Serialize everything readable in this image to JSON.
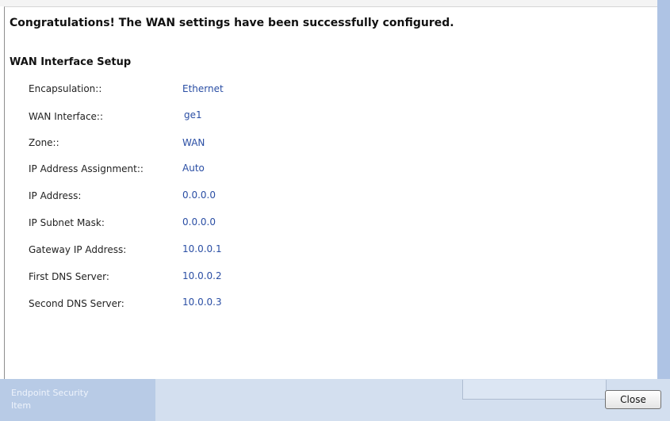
{
  "message": "Congratulations! The WAN settings have been successfully configured.",
  "section_title": "WAN Interface Setup",
  "fields": [
    {
      "label": "Encapsulation::",
      "value": "Ethernet"
    },
    {
      "label": "WAN Interface::",
      "value": "ge1"
    },
    {
      "label": "Zone::",
      "value": "WAN"
    },
    {
      "label": "IP Address Assignment::",
      "value": "Auto"
    },
    {
      "label": "IP Address:",
      "value": "0.0.0.0"
    },
    {
      "label": "IP Subnet Mask:",
      "value": "0.0.0.0"
    },
    {
      "label": "Gateway IP Address:",
      "value": "10.0.0.1"
    },
    {
      "label": "First DNS Server:",
      "value": "10.0.0.2"
    },
    {
      "label": "Second DNS Server:",
      "value": "10.0.0.3"
    }
  ],
  "background_text": "Endpoint Security Item",
  "close_label": "Close",
  "colors": {
    "value_text": "#2a4ea4",
    "accent_bar": "#aec3e4",
    "footer": "#d3dfef"
  }
}
